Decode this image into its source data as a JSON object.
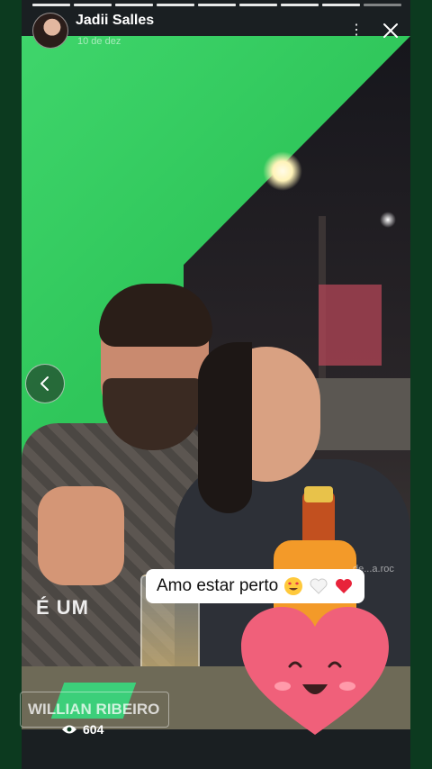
{
  "story": {
    "username": "Jadii Salles",
    "date": "10 de dez",
    "progress_total": 9,
    "progress_current_index": 8,
    "views": "604"
  },
  "overlays": {
    "caption_text": "Amo estar perto",
    "left_text": "É UM",
    "sticker_text": "WILLIAN RIBEIRO",
    "watermark": "de...a.roc"
  },
  "icons": {
    "more": "more-vertical-icon",
    "close": "close-icon",
    "back": "chevron-left-icon",
    "views": "eye-icon"
  },
  "colors": {
    "frame": "#0c3a1f",
    "green_wall": "#34c860",
    "heart": "#f0607a"
  }
}
